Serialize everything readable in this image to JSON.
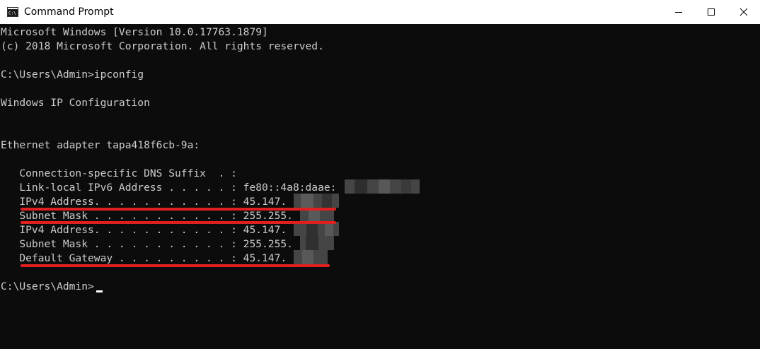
{
  "window": {
    "title": "Command Prompt",
    "icon": "cmd-icon",
    "controls": [
      "minimize-icon",
      "maximize-icon",
      "close-icon"
    ]
  },
  "console": {
    "lines": [
      "Microsoft Windows [Version 10.0.17763.1879]",
      "(c) 2018 Microsoft Corporation. All rights reserved.",
      "",
      "C:\\Users\\Admin>ipconfig",
      "",
      "Windows IP Configuration",
      "",
      "",
      "Ethernet adapter tapa418f6cb-9a:",
      "",
      "   Connection-specific DNS Suffix  . :",
      "   Link-local IPv6 Address . . . . . : fe80::4a8:daae:",
      "   IPv4 Address. . . . . . . . . . . : 45.147.",
      "   Subnet Mask . . . . . . . . . . . : 255.255.",
      "   IPv4 Address. . . . . . . . . . . : 45.147.",
      "   Subnet Mask . . . . . . . . . . . : 255.255.",
      "   Default Gateway . . . . . . . . . : 45.147.",
      "",
      "C:\\Users\\Admin>"
    ],
    "highlight_color": "#e02020",
    "text_color": "#cccccc",
    "background_color": "#0c0c0c"
  }
}
